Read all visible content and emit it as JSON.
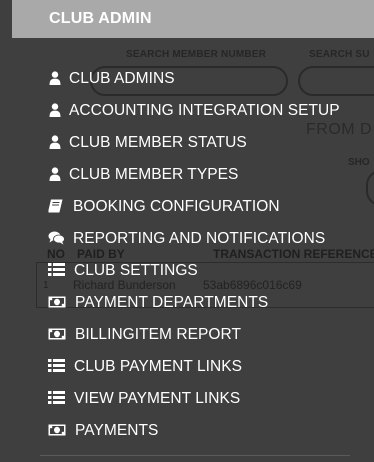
{
  "header": {
    "title": "CLUB ADMIN"
  },
  "background": {
    "search_member_label": "SEARCH MEMBER NUMBER",
    "search_second_label": "SEARCH SU",
    "from_label": "FROM D",
    "show_label": "SHO",
    "table": {
      "headers": [
        "NO",
        "PAID BY",
        "TRANSACTION REFERENCE"
      ],
      "rows": [
        {
          "no": "1",
          "paid_by": "Richard Bunderson",
          "reference": "53ab6896c016c69"
        }
      ]
    }
  },
  "menu": {
    "items": [
      {
        "label": "CLUB ADMINS",
        "icon": "user-icon"
      },
      {
        "label": "ACCOUNTING INTEGRATION SETUP",
        "icon": "user-icon"
      },
      {
        "label": "CLUB MEMBER STATUS",
        "icon": "user-icon"
      },
      {
        "label": "CLUB MEMBER TYPES",
        "icon": "user-icon"
      },
      {
        "label": "BOOKING CONFIGURATION",
        "icon": "book-icon"
      },
      {
        "label": "REPORTING AND NOTIFICATIONS",
        "icon": "comments-icon"
      },
      {
        "label": "CLUB SETTINGS",
        "icon": "list-icon"
      },
      {
        "label": "PAYMENT DEPARTMENTS",
        "icon": "money-icon"
      },
      {
        "label": "BILLINGITEM REPORT",
        "icon": "money-icon"
      },
      {
        "label": "CLUB PAYMENT LINKS",
        "icon": "list-icon"
      },
      {
        "label": "VIEW PAYMENT LINKS",
        "icon": "list-icon"
      },
      {
        "label": "PAYMENTS",
        "icon": "money-icon"
      }
    ]
  },
  "colors": {
    "header_bg": "#a9a9a9",
    "menu_bg": "#3f3f3f",
    "text": "#ffffff"
  }
}
